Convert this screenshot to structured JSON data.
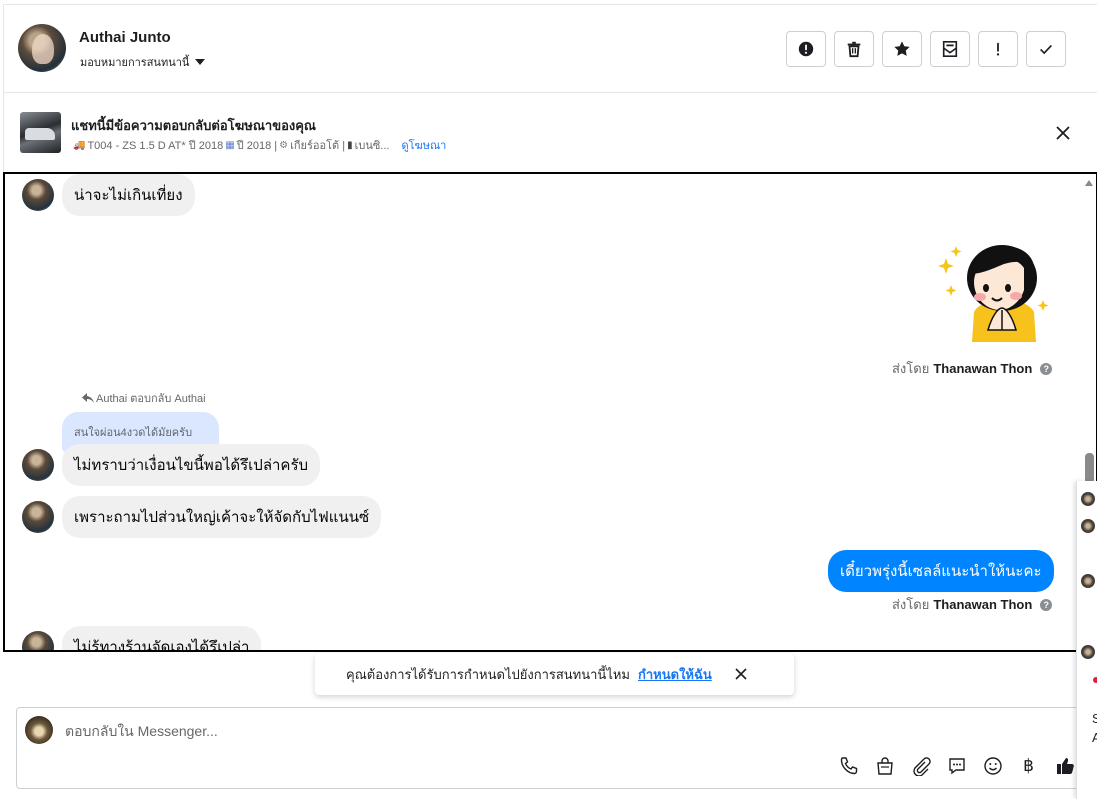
{
  "header": {
    "user_name": "Authai Junto",
    "assign_label": "มอบหมายการสนทนานี้",
    "actions": [
      {
        "name": "report-button",
        "icon": "exclamation-circle-icon"
      },
      {
        "name": "delete-button",
        "icon": "trash-icon"
      },
      {
        "name": "star-button",
        "icon": "star-icon"
      },
      {
        "name": "mark-unread-button",
        "icon": "envelope-icon"
      },
      {
        "name": "follow-up-button",
        "icon": "exclamation-icon"
      },
      {
        "name": "mark-done-button",
        "icon": "check-icon"
      }
    ]
  },
  "ad": {
    "title": "แชทนี้มีข้อความตอบกลับต่อโฆษณาของคุณ",
    "detail_model": "T004 - ZS 1.5 D AT* ปี 2018",
    "detail_year": "ปี 2018 |",
    "detail_gear": "เกียร์ออโต้ |",
    "detail_fuel": "เบนซิ...",
    "view_ad_link": "ดูโฆษณา"
  },
  "messages": {
    "m1": "น่าจะไม่เกินเที่ยง",
    "sent_by_prefix": "ส่งโดย",
    "sent_by_name": "Thanawan Thon",
    "reply_label": "Authai ตอบกลับ Authai",
    "reply_quote": "สนใจผ่อน4งวดได้มัยครับ",
    "m2": "ไม่ทราบว่าเงื่อนไขนี้พอได้รึเปล่าครับ",
    "m3": "เพราะถามไปส่วนใหญ่เค้าจะให้จัดกับไฟแนนซ์",
    "out1": "เดี๋ยวพรุ่งนี้เซลล์แนะนำให้นะคะ",
    "m4": "ไม่รู้ทางร้านจัดเองได้รึเปล่า"
  },
  "toast": {
    "text": "คุณต้องการได้รับการกำหนดไปยังการสนทนานี้ไหม",
    "link": "กำหนดให้ฉัน"
  },
  "composer": {
    "placeholder": "ตอบกลับใน Messenger...",
    "tools": [
      "phone-icon",
      "shopping-bag-icon",
      "paperclip-icon",
      "saved-reply-icon",
      "emoji-icon",
      "baht-icon",
      "thumbs-up-icon"
    ],
    "baht_symbol": "฿"
  },
  "side": {
    "letter_s": "S",
    "letter_a": "A"
  },
  "colors": {
    "accent": "#0084ff",
    "link": "#1877f2",
    "incoming_bubble": "#f0f0f0"
  }
}
